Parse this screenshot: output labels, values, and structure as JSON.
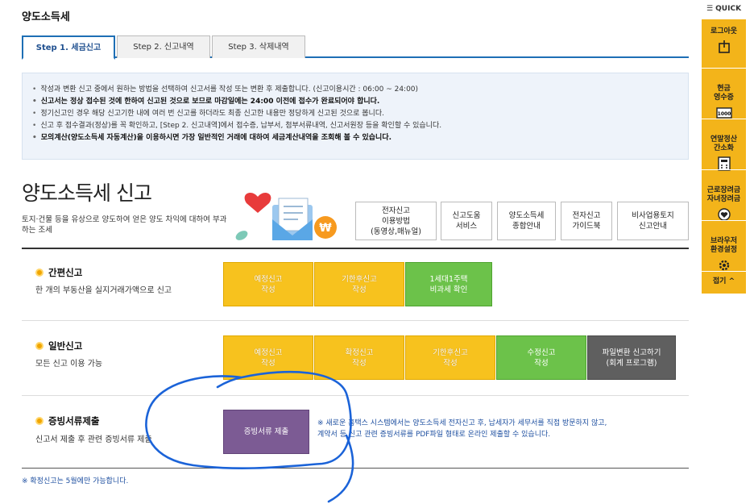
{
  "page_title": "양도소득세",
  "tabs": [
    {
      "label": "Step 1. 세금신고",
      "active": true
    },
    {
      "label": "Step 2. 신고내역",
      "active": false
    },
    {
      "label": "Step 3. 삭제내역",
      "active": false
    }
  ],
  "notice": [
    {
      "text": "작성과 변환 신고 중에서 원하는 방법을 선택하여 신고서를 작성 또는 변환 후 제출합니다. (신고이용시간 : 06:00 ~ 24:00)",
      "bold": false
    },
    {
      "text": "신고서는 정상 접수된 것에 한하여 신고된 것으로 보므로 마감일에는 24:00 이전에 접수가 완료되어야 합니다.",
      "bold": true
    },
    {
      "text": "정기신고인 경우 해당 신고기한 내에 여러 번 신고를 하더라도 최종 신고한 내용만 정당하게 신고된 것으로 봅니다.",
      "bold": false
    },
    {
      "text": "신고 후 접수결과(정상)를 꼭 확인하고, [Step 2. 신고내역]에서 접수증, 납부서, 첨부서류내역, 신고서원장 등을 확인할 수 있습니다.",
      "bold": false
    },
    {
      "text": "모의계산(양도소득세 자동계산)을 이용하시면 가장 일반적인 거래에 대하여 세금계산내역을 조회해 볼 수 있습니다.",
      "bold": true
    }
  ],
  "main": {
    "title": "양도소득세 신고",
    "desc": "토지·건물 등을 유상으로 양도하여 얻은 양도 차익에 대하여 부과하는 조세"
  },
  "help_buttons": [
    {
      "label": "전자신고\n이용방법\n(동영상,매뉴얼)"
    },
    {
      "label": "신고도움\n서비스"
    },
    {
      "label": "양도소득세\n종합안내"
    },
    {
      "label": "전자신고\n가이드북"
    },
    {
      "label": "비사업용토지\n신고안내"
    }
  ],
  "sections": {
    "simple": {
      "title": "간편신고",
      "desc": "한 개의 부동산을 실지거래가액으로 신고",
      "buttons": [
        "예정신고\n작성",
        "기한후신고\n작성",
        "1세대1주택\n비과세 확인"
      ]
    },
    "general": {
      "title": "일반신고",
      "desc": "모든 신고 이용 가능",
      "buttons": [
        "예정신고\n작성",
        "확정신고\n작성",
        "기한후신고\n작성",
        "수정신고\n작성",
        "파일변환 신고하기\n(회계 프로그램)"
      ]
    },
    "evidence": {
      "title": "증빙서류제출",
      "desc": "신고서 제출 후 관련 증빙서류 제출",
      "button": "증빙서류 제출",
      "note": "※ 새로운 홈택스 시스템에서는 양도소득세 전자신고 후, 납세자가 세무서를 직접 방문하지 않고,\n    계약서 등 신고 관련 증빙서류를 PDF파일 형태로 온라인 제출할 수 있습니다."
    }
  },
  "footnote": "※ 확정신고는 5월에만 가능합니다.",
  "quick": {
    "header": "☰ QUICK",
    "items": [
      {
        "label": "로그아웃",
        "icon": "logout-icon"
      },
      {
        "label": "현금\n영수증",
        "icon": "receipt-icon"
      },
      {
        "label": "연말정산\n간소화",
        "icon": "calculator-icon"
      },
      {
        "label": "근로장려금\n자녀장려금",
        "icon": "heart-hand-icon"
      },
      {
        "label": "브라우저\n환경설정",
        "icon": "gear-icon"
      },
      {
        "label": "접기 ^",
        "icon": ""
      }
    ]
  },
  "colors": {
    "accent": "#1e6fb5",
    "yellow_button": "#f7c21e",
    "green_button": "#6cc24a",
    "gray_button": "#5f5f5f",
    "purple_button": "#7c5b94",
    "quick_bg": "#f3b41a",
    "annotation_stroke": "#1b63d8"
  }
}
